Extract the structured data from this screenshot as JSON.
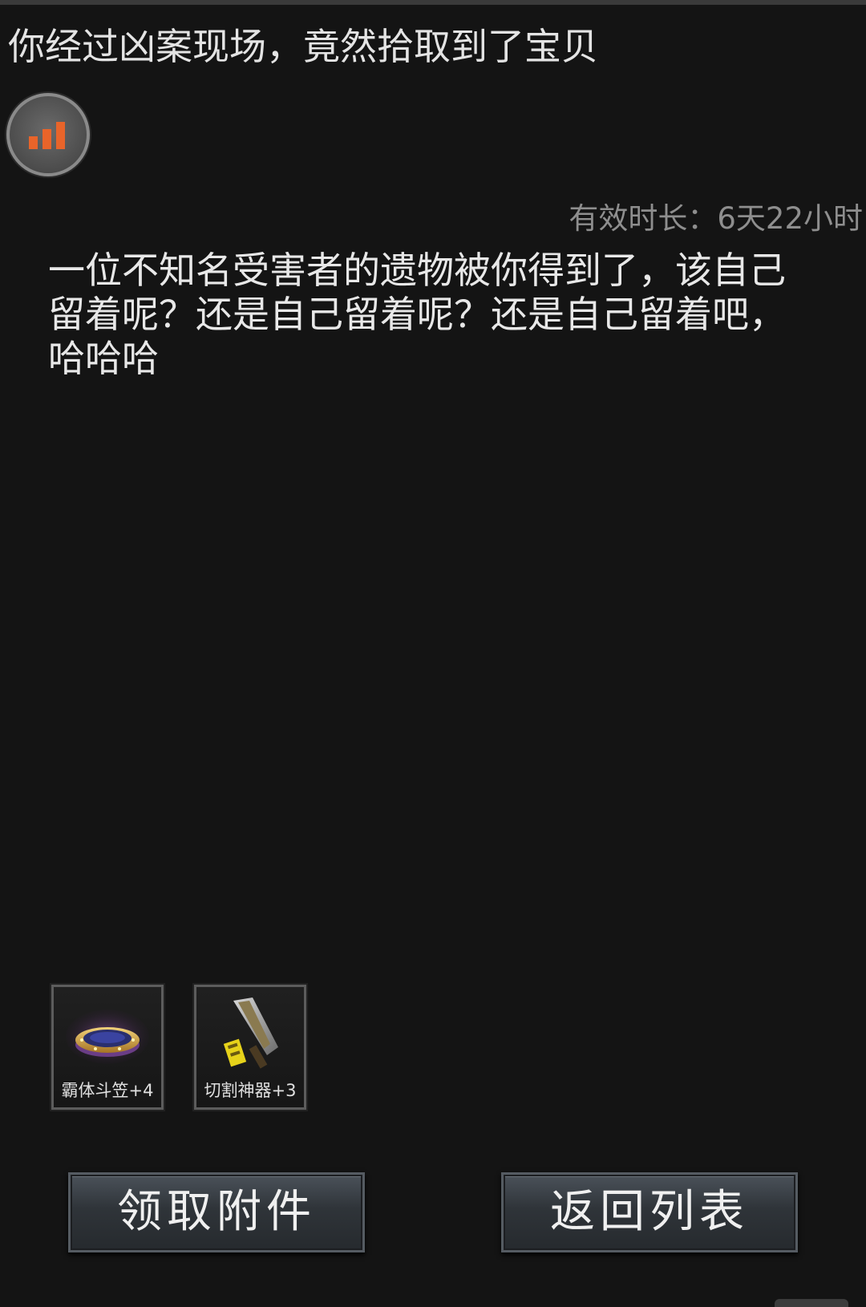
{
  "mail": {
    "title": "你经过凶案现场，竟然拾取到了宝贝",
    "validity": "有效时长：6天22小时",
    "body": "一位不知名受害者的遗物被你得到了，该自己留着呢？还是自己留着呢？还是自己留着吧，哈哈哈"
  },
  "icons": {
    "badge": "signal-bars-icon"
  },
  "attachments": [
    {
      "label": "霸体斗笠+4",
      "icon": "bamboo-hat-icon"
    },
    {
      "label": "切割神器+3",
      "icon": "cleaver-weapon-icon"
    }
  ],
  "buttons": {
    "claim_label": "领取附件",
    "back_label": "返回列表"
  },
  "colors": {
    "background": "#141414",
    "signal_bar": "#e8642a",
    "validity_text": "#8e8e8e"
  }
}
